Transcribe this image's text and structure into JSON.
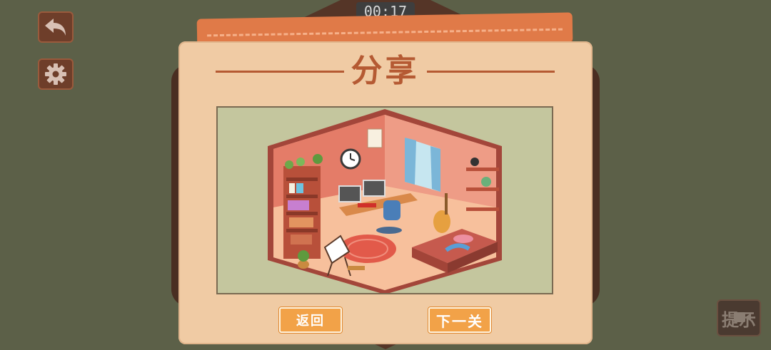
{
  "timer": "00:17",
  "dialog": {
    "title": "分享",
    "back_label": "返回",
    "next_label": "下一关"
  },
  "hint": {
    "label": "提示"
  },
  "icons": {
    "back": "undo-arrow-icon",
    "settings": "gear-icon",
    "hint": "video-icon"
  },
  "colors": {
    "background": "#5c6048",
    "dialog": "#f0cba4",
    "title": "#b55a33",
    "button": "#f2a248"
  }
}
